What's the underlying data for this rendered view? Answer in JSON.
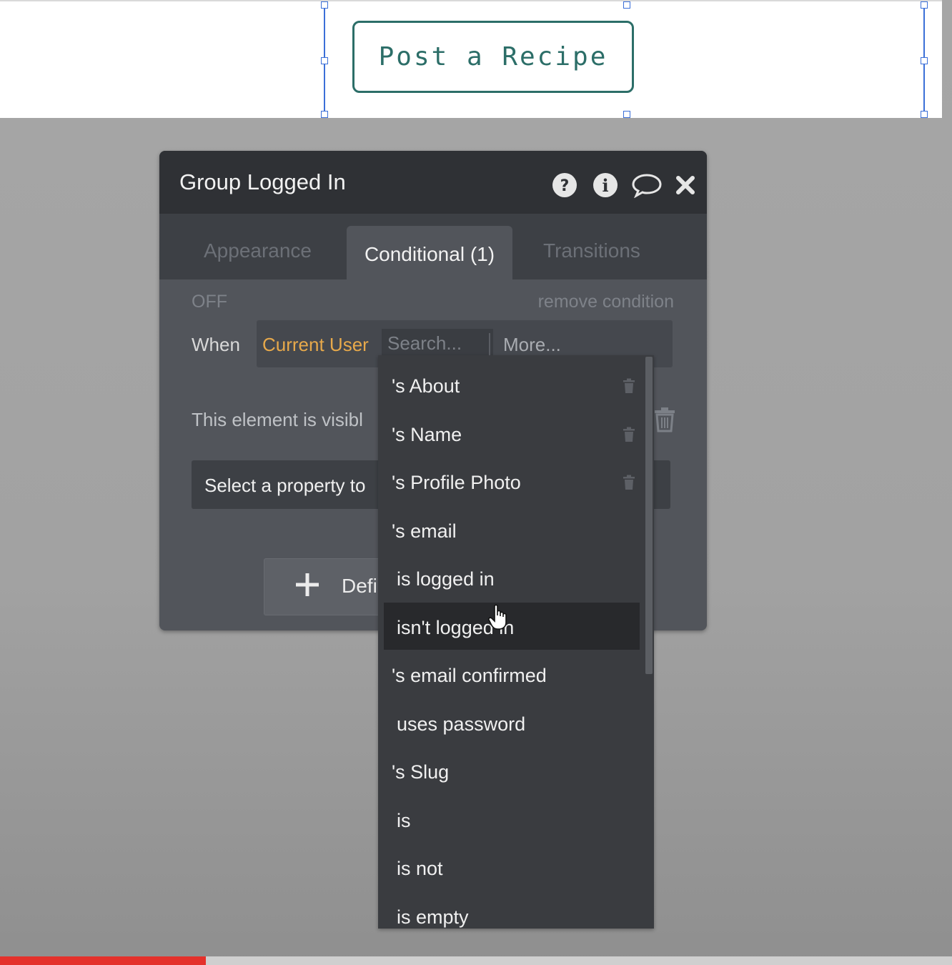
{
  "canvas": {
    "post_button_label": "Post a Recipe"
  },
  "panel": {
    "title": "Group Logged In",
    "header_icons": [
      "help-icon",
      "info-icon",
      "comment-icon",
      "close-icon"
    ],
    "tabs": [
      {
        "label": "Appearance",
        "active": false
      },
      {
        "label": "Conditional (1)",
        "active": true
      },
      {
        "label": "Transitions",
        "active": false
      }
    ],
    "condition": {
      "status": "OFF",
      "remove_label": "remove condition",
      "when_label": "When",
      "expression_source": "Current User",
      "search_placeholder": "Search...",
      "more_label": "More...",
      "visible_text": "This element is visibl",
      "select_property_label": "Select a property to",
      "define_button_label": "Defi"
    }
  },
  "dropdown": {
    "items": [
      {
        "label": "'s About",
        "has_trash": true,
        "indent": false
      },
      {
        "label": "'s Name",
        "has_trash": true,
        "indent": false
      },
      {
        "label": "'s Profile Photo",
        "has_trash": true,
        "indent": false
      },
      {
        "label": "'s email",
        "has_trash": false,
        "indent": false
      },
      {
        "label": "is logged in",
        "has_trash": false,
        "indent": true
      },
      {
        "label": "isn't logged in",
        "has_trash": false,
        "indent": true,
        "hovered": true
      },
      {
        "label": "'s email confirmed",
        "has_trash": false,
        "indent": false
      },
      {
        "label": "uses password",
        "has_trash": false,
        "indent": true
      },
      {
        "label": "'s Slug",
        "has_trash": false,
        "indent": false
      },
      {
        "label": "is",
        "has_trash": false,
        "indent": true
      },
      {
        "label": "is not",
        "has_trash": false,
        "indent": true
      },
      {
        "label": "is empty",
        "has_trash": false,
        "indent": true
      }
    ]
  },
  "video": {
    "progress": 0.216
  },
  "colors": {
    "accent_teal": "#2c6e68",
    "expression_orange": "#e7a94b",
    "selection_blue": "#3b6fd8",
    "progress_red": "#e4312b"
  }
}
